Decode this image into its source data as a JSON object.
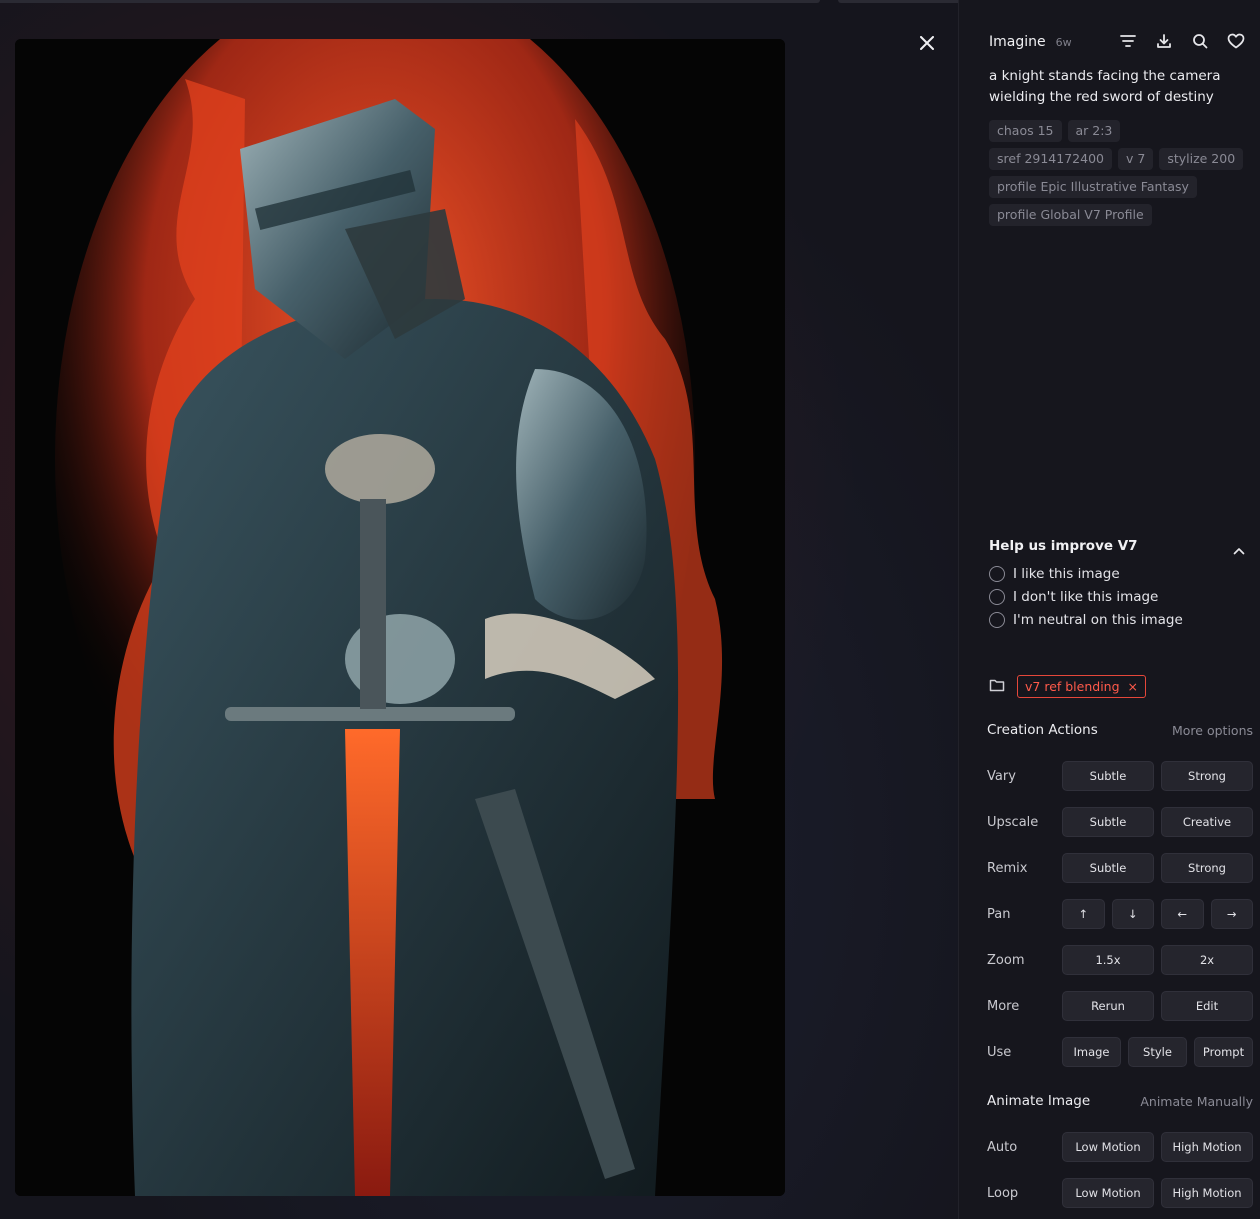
{
  "header": {
    "app_name": "Imagine",
    "age": "6w"
  },
  "header_icons": [
    "filter-lines-icon",
    "download-icon",
    "search-icon",
    "heart-icon"
  ],
  "prompt": "a knight stands facing the camera wielding the red sword of destiny",
  "params": [
    "chaos 15",
    "ar 2:3",
    "sref 2914172400",
    "v 7",
    "stylize 200",
    "profile Epic Illustrative Fantasy",
    "profile Global V7 Profile"
  ],
  "survey": {
    "title": "Help us improve V7",
    "options": [
      "I like this image",
      "I don't like this image",
      "I'm neutral on this image"
    ]
  },
  "folder_tag": {
    "label": "v7 ref blending",
    "remove": "×"
  },
  "creation": {
    "title": "Creation Actions",
    "more": "More options",
    "rows": {
      "vary": {
        "label": "Vary",
        "b1": "Subtle",
        "b2": "Strong"
      },
      "upscale": {
        "label": "Upscale",
        "b1": "Subtle",
        "b2": "Creative"
      },
      "remix": {
        "label": "Remix",
        "b1": "Subtle",
        "b2": "Strong"
      },
      "pan": {
        "label": "Pan",
        "b1": "↑",
        "b2": "↓",
        "b3": "←",
        "b4": "→"
      },
      "zoom": {
        "label": "Zoom",
        "b1": "1.5x",
        "b2": "2x"
      },
      "more": {
        "label": "More",
        "b1": "Rerun",
        "b2": "Edit"
      },
      "use": {
        "label": "Use",
        "b1": "Image",
        "b2": "Style",
        "b3": "Prompt"
      }
    }
  },
  "animate": {
    "title": "Animate Image",
    "manual": "Animate Manually",
    "rows": {
      "auto": {
        "label": "Auto",
        "b1": "Low Motion",
        "b2": "High Motion"
      },
      "loop": {
        "label": "Loop",
        "b1": "Low Motion",
        "b2": "High Motion"
      }
    }
  },
  "colors": {
    "accent_red": "#e5473a",
    "panel_bg": "#16161d",
    "button_bg": "#25252d"
  }
}
